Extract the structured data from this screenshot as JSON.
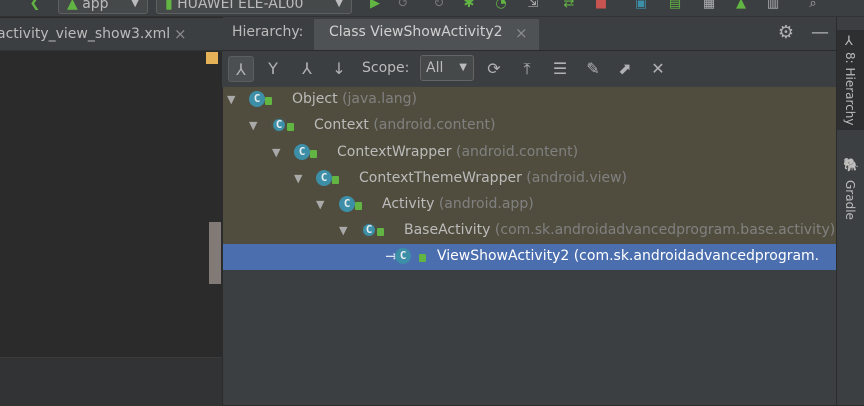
{
  "toolbar": {
    "module": "app",
    "device": "HUAWEI ELE-AL00"
  },
  "editor": {
    "tab_label": "activity_view_show3.xml",
    "tab_close": "×"
  },
  "panel": {
    "title": "Hierarchy:",
    "tab_label": "Class ViewShowActivity2",
    "tab_close": "×",
    "scope_label": "Scope:",
    "scope_value": "All"
  },
  "tree": [
    {
      "name": "Object",
      "package": "(java.lang)",
      "expanded": true,
      "selected": false
    },
    {
      "name": "Context",
      "package": "(android.content)",
      "expanded": true,
      "selected": false
    },
    {
      "name": "ContextWrapper",
      "package": "(android.content)",
      "expanded": true,
      "selected": false
    },
    {
      "name": "ContextThemeWrapper",
      "package": "(android.view)",
      "expanded": true,
      "selected": false
    },
    {
      "name": "Activity",
      "package": "(android.app)",
      "expanded": true,
      "selected": false
    },
    {
      "name": "BaseActivity",
      "package": "(com.sk.androidadvancedprogram.base.activity)",
      "expanded": true,
      "selected": false
    },
    {
      "name": "ViewShowActivity2",
      "package": "(com.sk.androidadvancedprogram.",
      "expanded": false,
      "selected": true
    }
  ],
  "right_strip": {
    "hierarchy_label": "8: Hierarchy",
    "gradle_label": "Gradle"
  },
  "colors": {
    "selection": "#4b6eaf",
    "tree_background": "#514d3e",
    "class_icon": "#3d8ea7",
    "lock_green": "#62b543"
  }
}
